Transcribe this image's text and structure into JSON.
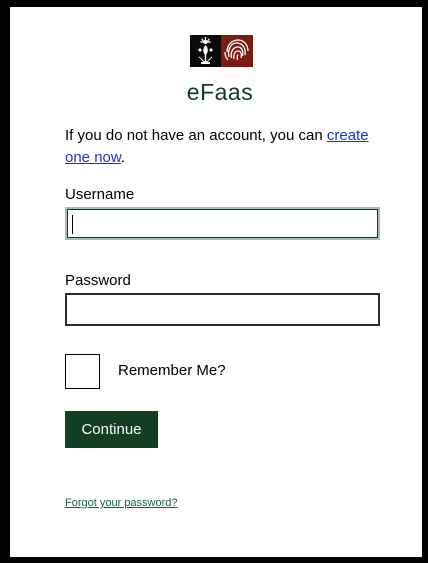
{
  "brand": {
    "logo_text": "eFaas",
    "left_emblem_icon": "national-emblem-icon",
    "right_emblem_icon": "fingerprint-icon"
  },
  "intro": {
    "text": "If you do not have an account, you can ",
    "link_text": "create one now",
    "suffix": "."
  },
  "form": {
    "username_label": "Username",
    "username_value": "",
    "password_label": "Password",
    "password_value": "",
    "remember_label": "Remember Me?",
    "remember_checked": false,
    "submit_label": "Continue",
    "forgot_link": "Forgot your password?"
  },
  "colors": {
    "primary_button": "#123e22",
    "link": "#1a36cf",
    "forgot_link": "#1b5c4c",
    "logo_dark": "#0b0b0b",
    "logo_red": "#7a1c12"
  }
}
